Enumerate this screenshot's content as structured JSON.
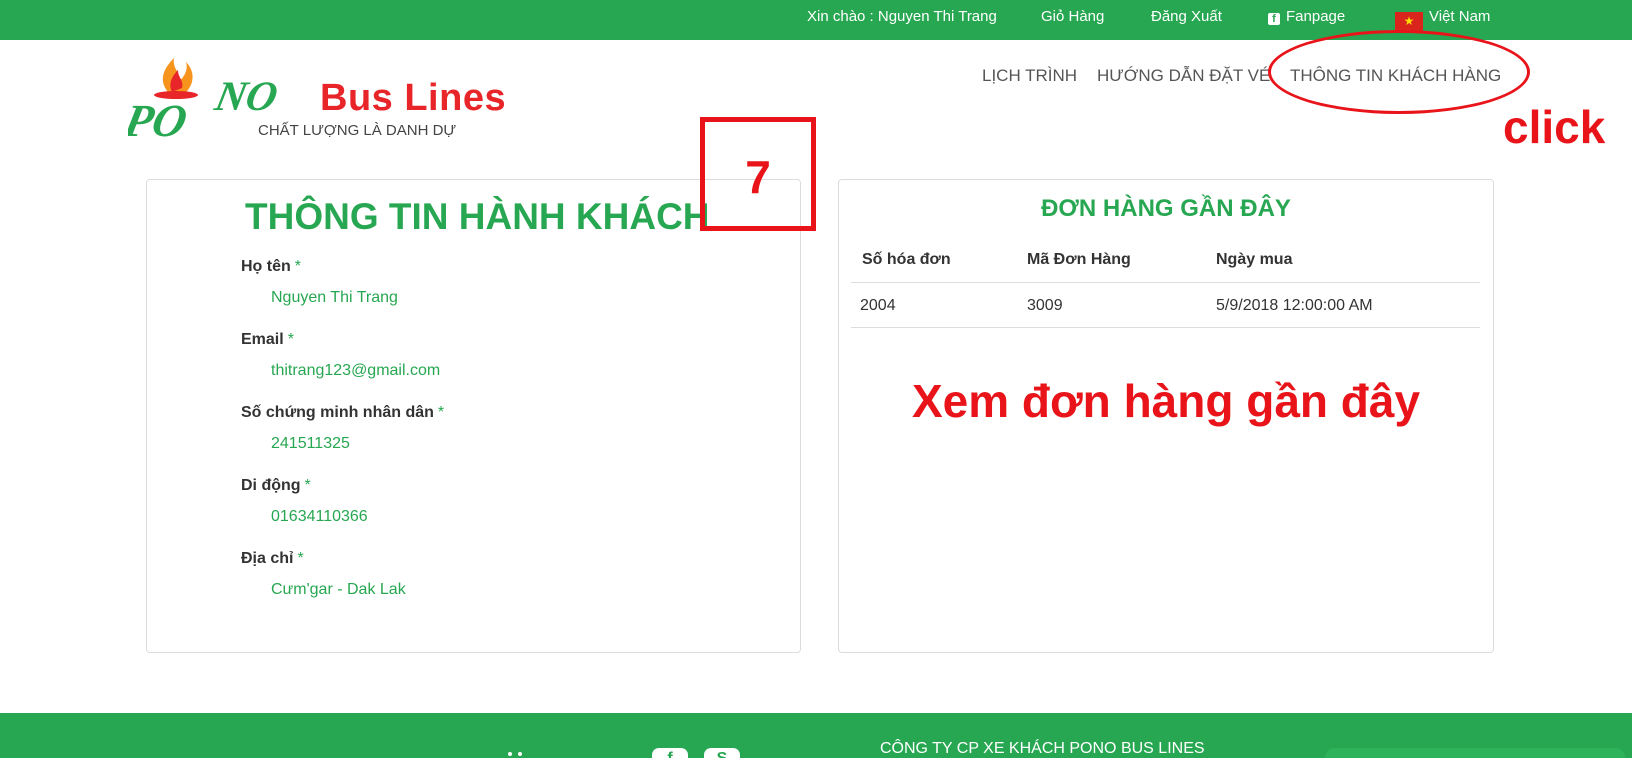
{
  "topbar": {
    "greeting": "Xin chào : Nguyen Thi Trang",
    "cart": "Giỏ Hàng",
    "logout": "Đăng Xuất",
    "fanpage": "Fanpage",
    "language": "Việt Nam"
  },
  "logo": {
    "brand": "Bus Lines",
    "tagline": "CHẤT LƯỢNG LÀ DANH DỰ",
    "mark": "PONO"
  },
  "nav": {
    "items": [
      "LỊCH TRÌNH",
      "HƯỚNG DẪN ĐẶT VÉ",
      "THÔNG TIN KHÁCH HÀNG"
    ]
  },
  "annotations": {
    "click": "click",
    "step": "7",
    "note": "Xem đơn hàng gần đây",
    "color": "#e8141a"
  },
  "passenger": {
    "title": "THÔNG TIN HÀNH KHÁCH",
    "required_mark": "*",
    "fields": [
      {
        "label": "Họ tên",
        "value": "Nguyen Thi Trang"
      },
      {
        "label": "Email",
        "value": "thitrang123@gmail.com"
      },
      {
        "label": "Số chứng minh nhân dân",
        "value": "241511325"
      },
      {
        "label": "Di động",
        "value": "01634110366"
      },
      {
        "label": "Địa chỉ",
        "value": "Cưm'gar - Dak Lak"
      }
    ]
  },
  "orders": {
    "title": "ĐƠN HÀNG GẦN ĐÂY",
    "columns": [
      "Số hóa đơn",
      "Mã Đơn Hàng",
      "Ngày mua"
    ],
    "rows": [
      [
        "2004",
        "3009",
        "5/9/2018 12:00:00 AM"
      ]
    ]
  },
  "footer": {
    "company": "CÔNG TY CP XE KHÁCH PONO BUS LINES"
  },
  "colors": {
    "brand_green": "#27a751",
    "brand_red": "#e8262a"
  }
}
